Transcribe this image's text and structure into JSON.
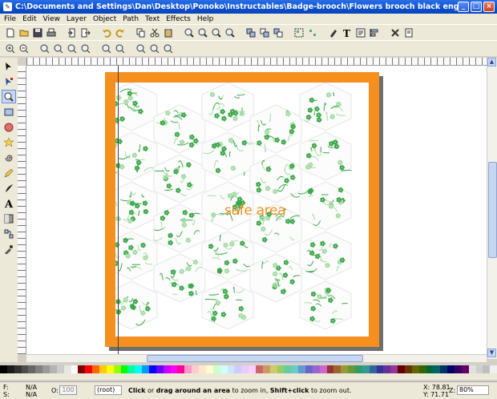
{
  "window": {
    "title": "C:\\Documents and Settings\\Dan\\Desktop\\Ponoko\\Instructables\\Badge-brooch\\Flowers brooch black engraving.eps - Inkscape",
    "minimize": "_",
    "maximize": "□",
    "close": "×"
  },
  "menu": {
    "items": [
      "File",
      "Edit",
      "View",
      "Layer",
      "Object",
      "Path",
      "Text",
      "Effects",
      "Help"
    ]
  },
  "toolbar1": {
    "icons": [
      "new-document-icon",
      "open-icon",
      "save-icon",
      "print-icon",
      "import-icon",
      "export-icon",
      "undo-icon",
      "redo-icon",
      "copy-icon",
      "cut-icon",
      "paste-icon",
      "zoom-selection-icon",
      "zoom-drawing-icon",
      "zoom-page-icon",
      "zoom-width-icon",
      "duplicate-icon",
      "clone-icon",
      "unlink-clone-icon",
      "group-icon",
      "ungroup-icon",
      "fill-stroke-icon",
      "text-font-icon",
      "xml-editor-icon",
      "align-icon",
      "preferences-icon",
      "document-properties-icon"
    ]
  },
  "toolbar2": {
    "icons": [
      "zoom-in-icon",
      "zoom-out-icon",
      "zoom-1-1-icon",
      "zoom-1-2-icon",
      "zoom-2-1-icon",
      "zoom-selection-icon",
      "zoom-drawing-icon",
      "zoom-page-icon",
      "zoom-width-icon",
      "zoom-prev-icon",
      "zoom-next-icon"
    ]
  },
  "toolbox": {
    "tools": [
      "selector-tool",
      "node-tool",
      "zoom-tool",
      "rect-tool",
      "ellipse-tool",
      "star-tool",
      "spiral-tool",
      "pencil-tool",
      "calligraphy-tool",
      "text-tool",
      "gradient-tool",
      "connector-tool",
      "dropper-tool"
    ],
    "active": "zoom-tool"
  },
  "canvas": {
    "label": "safe area",
    "border_color": "#f5901e",
    "flower_color": "#3da84a",
    "flower_light": "#a6dca5"
  },
  "palette": {
    "colors": [
      "#000000",
      "#1a1a1a",
      "#333333",
      "#4d4d4d",
      "#666666",
      "#808080",
      "#999999",
      "#b3b3b3",
      "#cccccc",
      "#e6e6e6",
      "#ffffff",
      "#800000",
      "#ff0000",
      "#ff6600",
      "#ffcc00",
      "#ffff00",
      "#99ff00",
      "#00ff00",
      "#00ff99",
      "#00ffff",
      "#0099ff",
      "#0000ff",
      "#6600ff",
      "#cc00ff",
      "#ff00ff",
      "#ff0099",
      "#ff99cc",
      "#ffcccc",
      "#ffe6cc",
      "#ffffcc",
      "#ccffcc",
      "#ccffff",
      "#cce6ff",
      "#ccccff",
      "#e6ccff",
      "#ffccff",
      "#cc6666",
      "#cc9966",
      "#cccc66",
      "#99cc66",
      "#66cc99",
      "#66cccc",
      "#6699cc",
      "#6666cc",
      "#9966cc",
      "#cc66cc",
      "#993333",
      "#996633",
      "#999933",
      "#669933",
      "#339966",
      "#339999",
      "#336699",
      "#333399",
      "#663399",
      "#993399",
      "#660000",
      "#663300",
      "#666600",
      "#336600",
      "#006633",
      "#006666",
      "#003366",
      "#000066",
      "#330066",
      "#660066",
      "#e0e0e0",
      "#d0d0d0",
      "#c0c0c0",
      "#f0f0f0"
    ]
  },
  "status": {
    "fill_label": "F:",
    "stroke_label": "S:",
    "fill_value": "N/A",
    "stroke_value": "N/A",
    "opacity_label": "O:",
    "opacity_value": "100",
    "layer": "(root)",
    "message_prefix": "Click",
    "message_mid": " or ",
    "message_bold2": "drag around an area",
    "message_mid2": " to zoom in, ",
    "message_bold3": "Shift+click",
    "message_end": " to zoom out.",
    "x_label": "X:",
    "x_value": "78.81",
    "y_label": "Y:",
    "y_value": "71.71",
    "zoom_label": "Z:",
    "zoom_value": "80%"
  }
}
